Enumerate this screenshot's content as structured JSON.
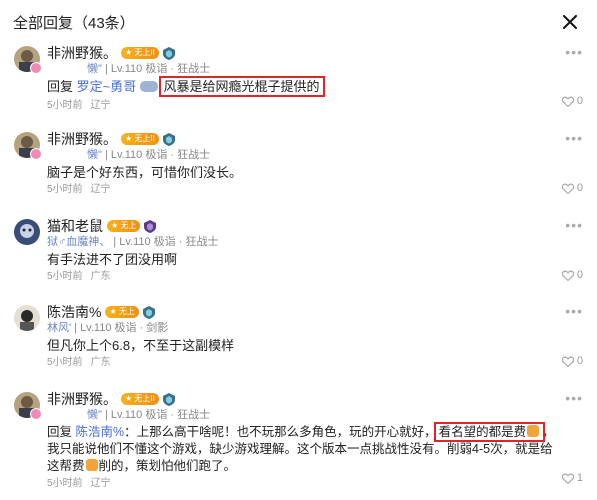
{
  "header": {
    "title": "全部回复（43条）"
  },
  "comments": [
    {
      "name": "非洲野猴。",
      "vip": "★ 无上II",
      "meta_a": "懒\"",
      "meta_b": " | Lv.110 极诣 · 狂战士",
      "reply_prefix": "回复",
      "reply_to": "罗定",
      "reply_sep": "~",
      "reply_to2": "勇哥",
      "text": "风暴是给网瘾光棍子提供的",
      "time": "5小时前",
      "location": "辽宁",
      "likes": "0"
    },
    {
      "name": "非洲野猴。",
      "vip": "★ 无上II",
      "meta_a": "懒\"",
      "meta_b": " | Lv.110 极诣 · 狂战士",
      "text": "脑子是个好东西，可惜你们没长。",
      "time": "5小时前",
      "location": "辽宁",
      "likes": "0"
    },
    {
      "name": "猫和老鼠",
      "vip": "★ 无上",
      "meta_a": "狱♂血魔神、",
      "meta_b": " | Lv.110 极诣 · 狂战士",
      "text": "有手法进不了团没用啊",
      "time": "5小时前",
      "location": "广东",
      "likes": "0"
    },
    {
      "name": "陈浩南%",
      "vip": "★ 无上",
      "meta_a": "林风'",
      "meta_b": " | Lv.110 极诣 · 剑影",
      "text": "但凡你上个6.8，不至于这副模样",
      "time": "5小时前",
      "location": "广东",
      "likes": "0"
    },
    {
      "name": "非洲野猴。",
      "vip": "★ 无上II",
      "meta_a": "懒\"",
      "meta_b": " | Lv.110 极诣 · 狂战士",
      "reply_prefix": "回复",
      "reply_to": "陈浩南%",
      "text_a": "：上那么高干啥呢！也不玩那么多角色，玩的开心就好，",
      "highlight": "看名望的都是费",
      "text_b": "，我只能说他们不懂这个游戏，缺少游戏理解。这个版本一点挑战性没有。削弱4-5次，就是给这帮费",
      "text_c": "削的，策划怕他们跑了。",
      "time": "5小时前",
      "location": "辽宁",
      "likes": "1"
    }
  ]
}
